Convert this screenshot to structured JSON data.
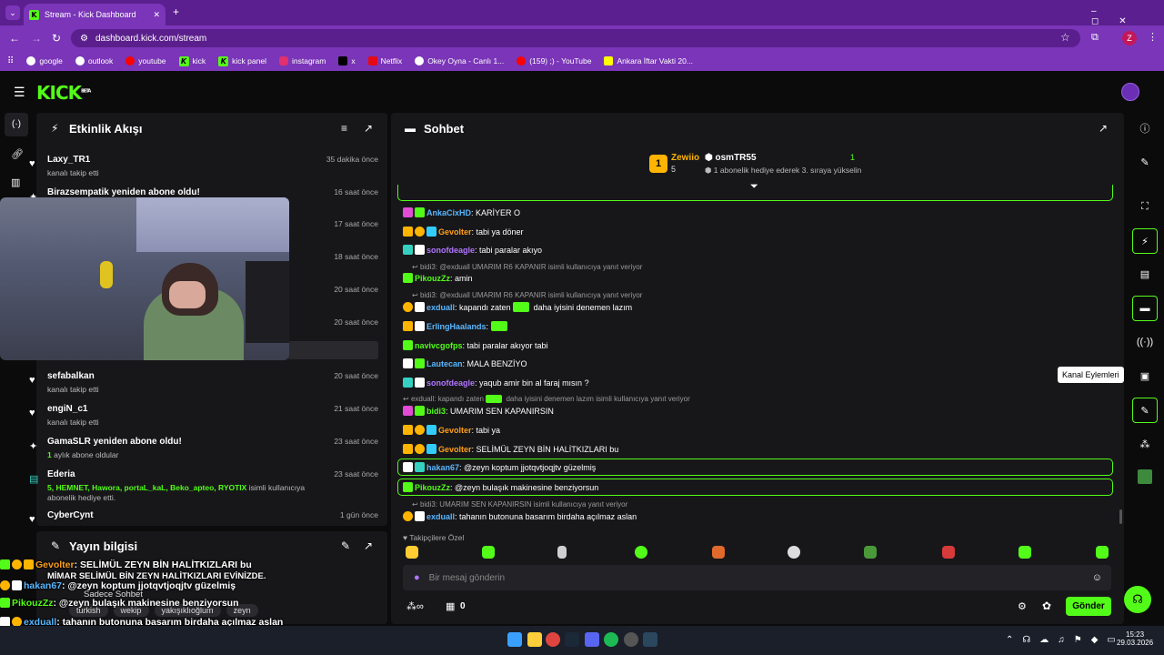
{
  "browser": {
    "tab_title": "Stream - Kick Dashboard",
    "url": "dashboard.kick.com/stream",
    "avatar_letter": "Z",
    "bookmarks": [
      "google",
      "outlook",
      "youtube",
      "kick",
      "kick panel",
      "instagram",
      "x",
      "Netflix",
      "Okey Oyna - Canlı 1...",
      "(159) ;) - YouTube",
      "Ankara İftar Vakti 20..."
    ]
  },
  "brand": {
    "logo": "KICK",
    "beta": "BETA",
    "accent": "#53fc18"
  },
  "activity": {
    "title": "Etkinlik Akışı",
    "items": [
      {
        "name": "Laxy_TR1",
        "sub": "kanalı takip etti",
        "time": "35 dakika önce",
        "icon": "heart-icon"
      },
      {
        "name": "Birazsempatik yeniden abone oldu!",
        "sub": "",
        "time": "16 saat önce",
        "icon": "sparkle-icon"
      },
      {
        "name": "",
        "sub": "",
        "time": "17 saat önce",
        "icon": ""
      },
      {
        "name": "",
        "sub": "",
        "time": "18 saat önce",
        "icon": ""
      },
      {
        "name": "",
        "sub": "",
        "time": "20 saat önce",
        "icon": ""
      },
      {
        "name": "",
        "sub": "",
        "time": "20 saat önce",
        "icon": ""
      },
      {
        "name": "sefabalkan",
        "sub": "kanalı takip etti",
        "time": "20 saat önce",
        "icon": "heart-icon"
      },
      {
        "name": "engiN_c1",
        "sub": "kanalı takip etti",
        "time": "21 saat önce",
        "icon": "heart-icon"
      },
      {
        "name": "GamaSLR yeniden abone oldu!",
        "sub_num": "1",
        "sub": "aylık abone oldular",
        "time": "23 saat önce",
        "icon": "sparkle-icon"
      },
      {
        "name": "Ederia",
        "sub": "isimli kullanıcıya abonelik hediye etti.",
        "time": "23 saat önce",
        "icon": "gift-icon",
        "gift_to": "5, HEMNET, Hawora, portaL_kaL, Beko_apteo, RYOTIX"
      },
      {
        "name": "CyberCynt",
        "sub": "",
        "time": "1 gün önce",
        "icon": "heart-icon"
      }
    ]
  },
  "stream_info": {
    "title": "Yayın bilgisi",
    "mode": "Sadece Sohbet",
    "tags": [
      "turkish",
      "wekip",
      "yakışıklıoğlum",
      "zeyn"
    ]
  },
  "chat": {
    "title": "Sohbet",
    "gift_leader": {
      "user1": "Zewiio",
      "user1_count": "5",
      "rank": "1",
      "user2": "osmTR55",
      "user2_count": "1",
      "message": "1 abonelik hediye ederek 3. sıraya yükselin"
    },
    "messages": [
      {
        "user": "AnkaCixHD",
        "color": "#59b7ff",
        "text": ": KARİYER O"
      },
      {
        "user": "Gevolter",
        "color": "#ff9f1a",
        "text": ": tabi ya döner"
      },
      {
        "user": "sonofdeagle",
        "color": "#b276ff",
        "text": ": tabi paralar akıyo"
      },
      {
        "reply": "bidi3: @exduall UMARIM R6 KAPANIR isimli kullanıcıya yanıt veriyor"
      },
      {
        "user": "PikouzZz",
        "color": "#53fc18",
        "text": ": amin"
      },
      {
        "reply": "bidi3: @exduall UMARIM R6 KAPANIR isimli kullanıcıya yanıt veriyor"
      },
      {
        "user": "exduall",
        "color": "#59b7ff",
        "text": ": kapandı zaten",
        "text2": "daha iyisini denemen lazım"
      },
      {
        "user": "ErlingHaalands",
        "color": "#59b7ff",
        "text": ":"
      },
      {
        "user": "navivcgofps",
        "color": "#53fc18",
        "text": ": tabi paralar akıyor tabi"
      },
      {
        "user": "Lautecan",
        "color": "#59b7ff",
        "text": ": MALA BENZİYO"
      },
      {
        "user": "sonofdeagle",
        "color": "#b276ff",
        "text": ": yaqub amir bin al faraj mısın ?"
      },
      {
        "reply": "exduall: kapandı zaten",
        "reply2": "daha iyisini denemen lazım isimli kullanıcıya yanıt veriyor"
      },
      {
        "user": "bidi3",
        "color": "#53fc18",
        "text": ": UMARIM SEN KAPANIRSIN"
      },
      {
        "user": "Gevolter",
        "color": "#ff9f1a",
        "text": ": tabi ya"
      },
      {
        "user": "Gevolter",
        "color": "#ff9f1a",
        "text": ": SELİMÜL ZEYN BİN HALİTKIZLARI bu"
      },
      {
        "user": "hakan67",
        "color": "#59b7ff",
        "text": ": @zeyn koptum jjotqvtjoqjtv güzelmiş"
      },
      {
        "user": "PikouzZz",
        "color": "#53fc18",
        "text": ": @zeyn bulaşık makinesine benziyorsun"
      },
      {
        "reply": "bidi3: UMARIM SEN KAPANIRSIN isimli kullanıcıya yanıt veriyor"
      },
      {
        "user": "exduall",
        "color": "#59b7ff",
        "text": ": tahanın butonuna basarım birdaha açılmaz aslan"
      }
    ],
    "followers_label": "Takipçilere Özel",
    "input_placeholder": "Bir mesaj gönderin",
    "points": "0",
    "send_label": "Gönder"
  },
  "sidebar": {
    "tooltip": "Kanal Eylemleri"
  },
  "overlay": {
    "lines": [
      {
        "user": "Gevolter",
        "text": ": SELİMÜL ZEYN BİN HALİTKIZLARI bu"
      },
      {
        "user": "",
        "text": "MİMAR SELİMÜL BİN ZEYN HALİTKIZLARI EVİNİZDE."
      },
      {
        "user": "hakan67",
        "text": ": @zeyn koptum jjotqvtjoqjtv güzelmiş"
      },
      {
        "user": "PikouzZz",
        "text": ": @zeyn bulaşık makinesine benziyorsun"
      },
      {
        "user": "exduall",
        "text": ": tahanın butonuna basarım birdaha açılmaz aslan"
      }
    ]
  },
  "taskbar": {
    "time": "15:23",
    "date": "29.03.2026"
  }
}
